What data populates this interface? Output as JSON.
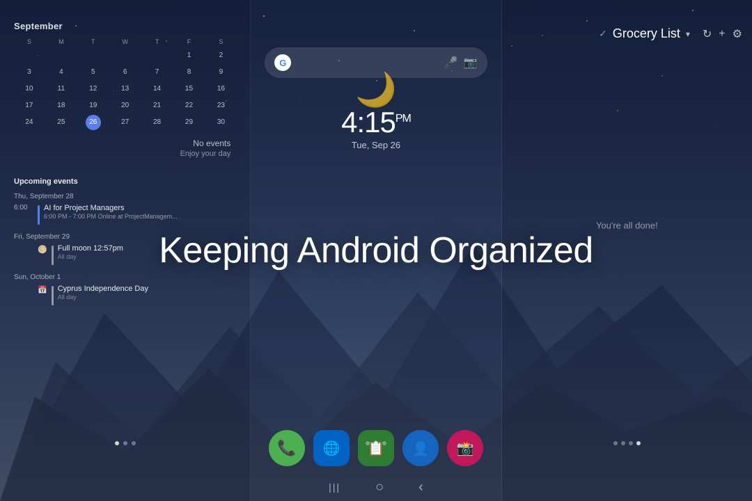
{
  "overlay": {
    "title": "Keeping Android Organized"
  },
  "left_panel": {
    "calendar": {
      "month": "September",
      "headers": [
        "S",
        "M",
        "T",
        "W",
        "T",
        "F",
        "S"
      ],
      "days": [
        {
          "day": "",
          "empty": true
        },
        {
          "day": "",
          "empty": true
        },
        {
          "day": "",
          "empty": true
        },
        {
          "day": "",
          "empty": true
        },
        {
          "day": "",
          "empty": true
        },
        {
          "day": "1",
          "empty": false
        },
        {
          "day": "2",
          "empty": false
        },
        {
          "day": "3",
          "empty": false
        },
        {
          "day": "4",
          "empty": false
        },
        {
          "day": "5",
          "empty": false
        },
        {
          "day": "6",
          "empty": false
        },
        {
          "day": "7",
          "empty": false
        },
        {
          "day": "8",
          "empty": false
        },
        {
          "day": "9",
          "empty": false
        },
        {
          "day": "10",
          "empty": false
        },
        {
          "day": "11",
          "empty": false
        },
        {
          "day": "12",
          "empty": false
        },
        {
          "day": "13",
          "empty": false
        },
        {
          "day": "14",
          "empty": false
        },
        {
          "day": "15",
          "empty": false
        },
        {
          "day": "16",
          "empty": false
        },
        {
          "day": "17",
          "empty": false
        },
        {
          "day": "18",
          "empty": false
        },
        {
          "day": "19",
          "empty": false
        },
        {
          "day": "20",
          "empty": false
        },
        {
          "day": "21",
          "empty": false
        },
        {
          "day": "22",
          "empty": false
        },
        {
          "day": "23",
          "empty": false
        },
        {
          "day": "24",
          "empty": false
        },
        {
          "day": "25",
          "empty": false
        },
        {
          "day": "26",
          "today": true
        },
        {
          "day": "27",
          "empty": false
        },
        {
          "day": "28",
          "empty": false
        },
        {
          "day": "29",
          "empty": false
        },
        {
          "day": "30",
          "empty": false
        }
      ],
      "no_events": {
        "title": "No events",
        "subtitle": "Enjoy your day"
      }
    },
    "upcoming": {
      "title": "Upcoming events",
      "events": [
        {
          "date_label": "Thu, September 28",
          "items": [
            {
              "time": "6:00",
              "name": "AI for Project Managers",
              "sub": "6:00 PM - 7:00 PM Online at ProjectManagem...",
              "type": "appointment"
            }
          ]
        },
        {
          "date_label": "Fri, September 29",
          "items": [
            {
              "time": "",
              "name": "Full moon 12:57pm",
              "sub": "All day",
              "type": "full-moon"
            }
          ]
        },
        {
          "date_label": "Sun, October 1",
          "items": [
            {
              "time": "",
              "name": "Cyprus Independence Day",
              "sub": "All day",
              "type": "holiday"
            }
          ]
        }
      ]
    },
    "dots": [
      {
        "active": true
      },
      {
        "active": false
      },
      {
        "active": false
      }
    ]
  },
  "center_panel": {
    "clock": {
      "time": "4:15",
      "ampm": "PM",
      "date": "Tue, Sep 26"
    },
    "search": {
      "logo": "G",
      "mic_icon": "🎤",
      "lens_icon": "📷"
    },
    "apps": [
      {
        "name": "Phone",
        "type": "phone",
        "icon": "📞"
      },
      {
        "name": "Edge",
        "type": "edge",
        "icon": "🌐"
      },
      {
        "name": "Notes",
        "type": "notes",
        "icon": "📋"
      },
      {
        "name": "Contacts",
        "type": "contacts",
        "icon": "👤"
      },
      {
        "name": "Camera",
        "type": "camera",
        "icon": "📸"
      }
    ],
    "nav": [
      {
        "icon": "|||",
        "name": "recents"
      },
      {
        "icon": "○",
        "name": "home"
      },
      {
        "icon": "‹",
        "name": "back"
      }
    ],
    "dots": [
      {
        "active": false
      },
      {
        "active": true
      },
      {
        "active": false
      }
    ]
  },
  "right_panel": {
    "grocery_title": "Grocery List",
    "done_text": "You're all done!",
    "dots": [
      {
        "active": false
      },
      {
        "active": false
      },
      {
        "active": true
      },
      {
        "active": false
      }
    ]
  }
}
